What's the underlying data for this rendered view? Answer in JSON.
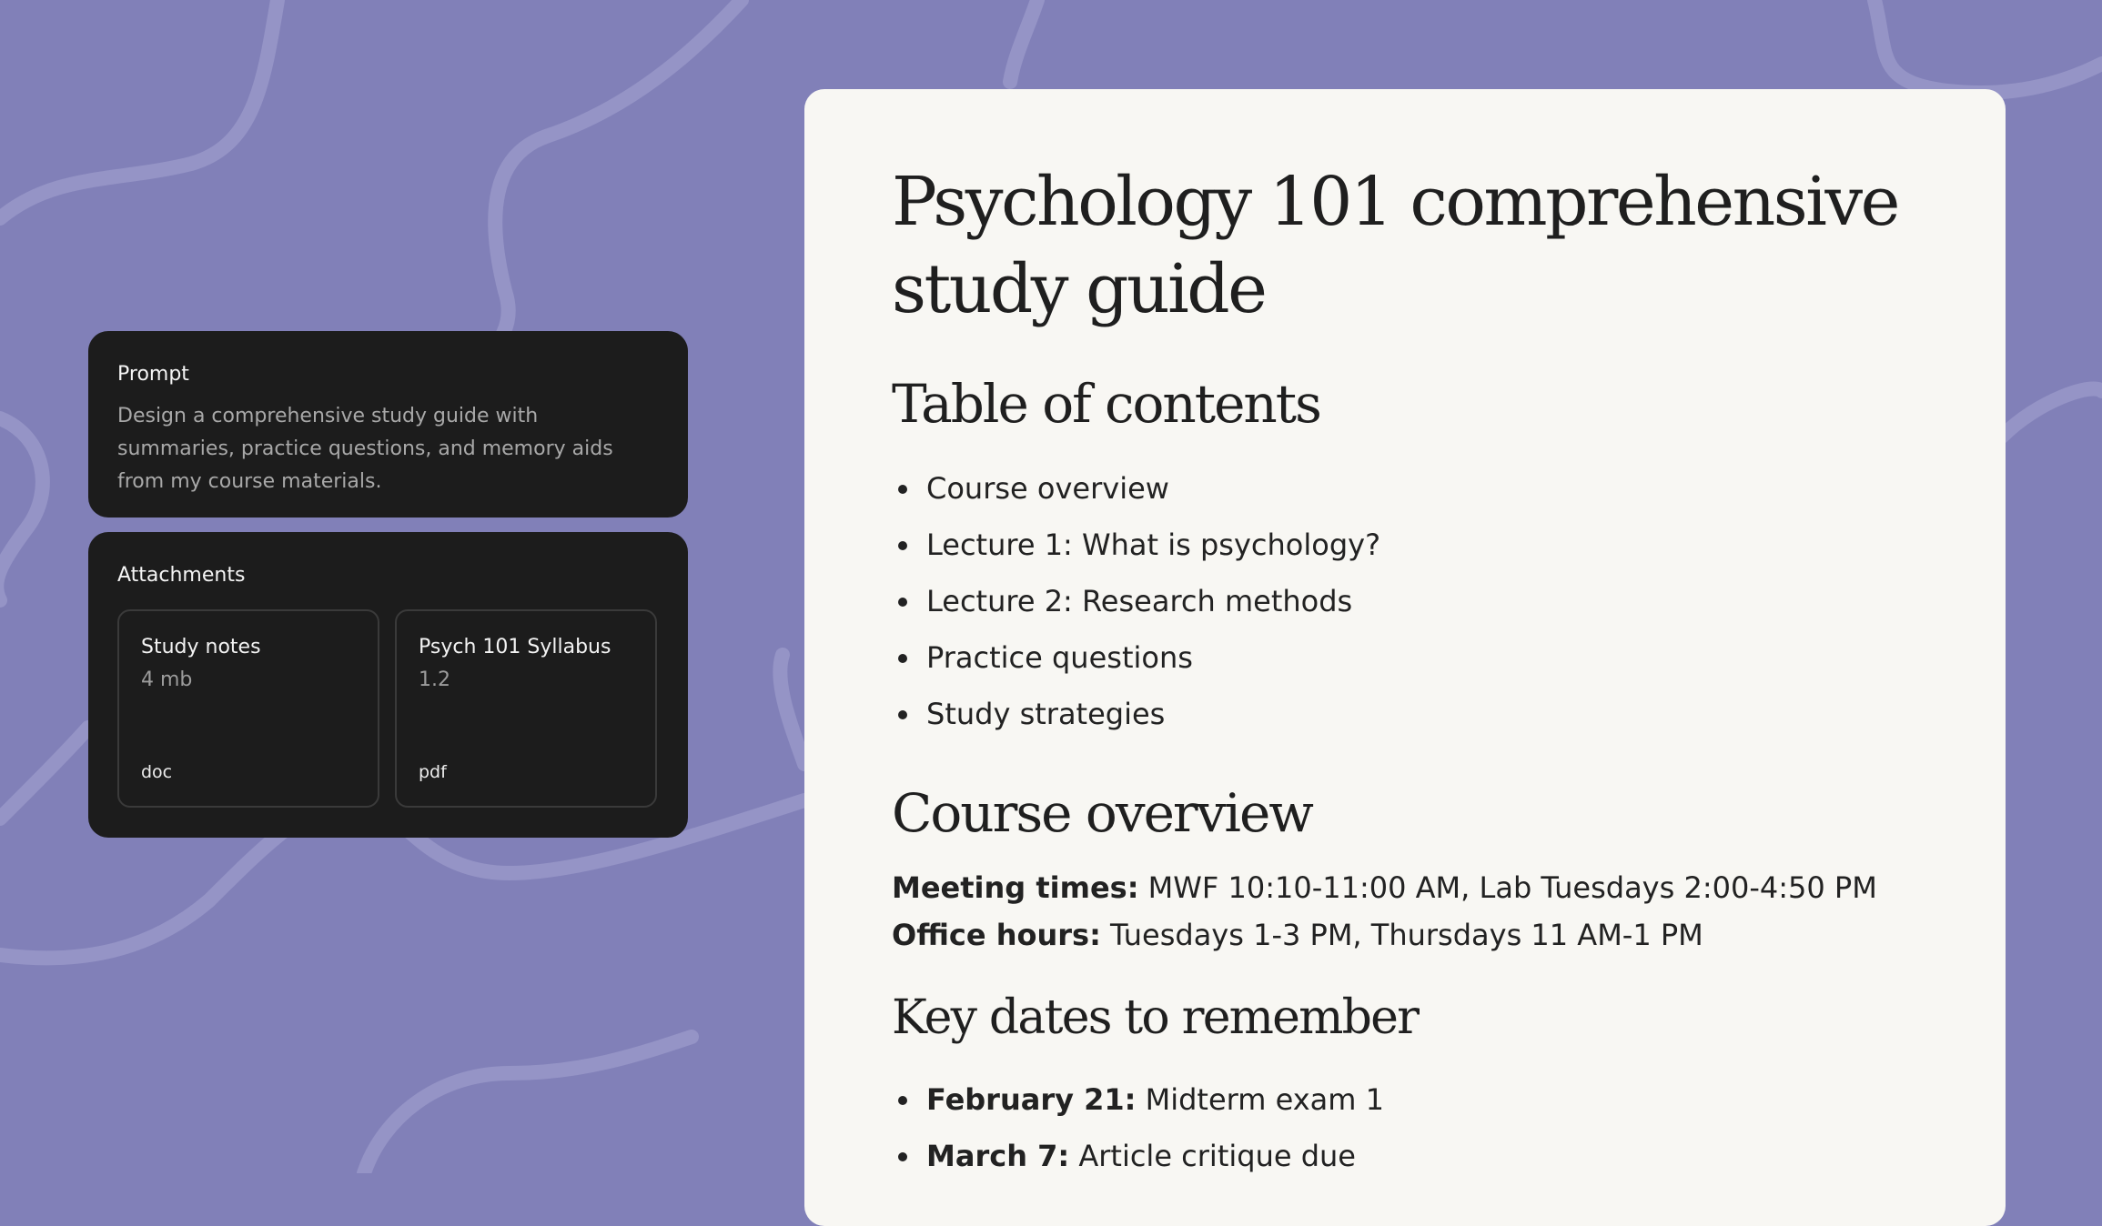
{
  "prompt": {
    "title": "Prompt",
    "text": "Design a comprehensive study guide with summaries, practice questions, and memory aids from my course materials."
  },
  "attachments": {
    "title": "Attachments",
    "items": [
      {
        "name": "Study notes",
        "size": "4 mb",
        "type": "doc"
      },
      {
        "name": "Psych 101 Syllabus",
        "size": "1.2",
        "type": "pdf"
      }
    ]
  },
  "document": {
    "title": "Psychology 101 comprehensive study guide",
    "toc_heading": "Table of contents",
    "toc": [
      "Course overview",
      "Lecture 1: What is psychology?",
      "Lecture 2: Research methods",
      "Practice questions",
      "Study strategies"
    ],
    "overview_heading": "Course overview",
    "meeting_label": "Meeting times:",
    "meeting_value": " MWF 10:10-11:00 AM, Lab Tuesdays 2:00-4:50 PM",
    "office_label": "Office hours:",
    "office_value": " Tuesdays 1-3 PM, Thursdays 11 AM-1 PM",
    "dates_heading": "Key dates to remember",
    "dates": [
      {
        "date": "February 21:",
        "event": " Midterm exam 1"
      },
      {
        "date": "March 7:",
        "event": " Article critique due"
      }
    ]
  },
  "colors": {
    "background": "#8180b8",
    "card": "#1c1c1c",
    "document": "#f8f7f3"
  }
}
